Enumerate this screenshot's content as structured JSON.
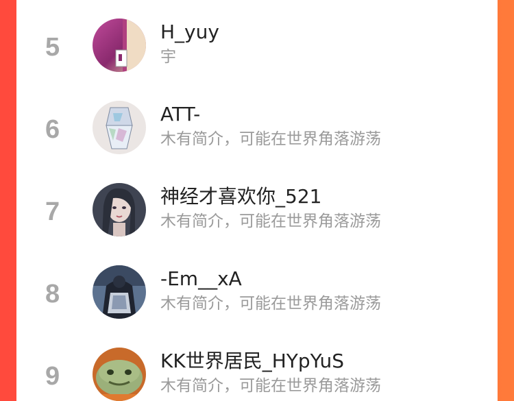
{
  "colors": {
    "background_left": "#ff4a3d",
    "background_right": "#ff7b3a",
    "panel": "#ffffff",
    "rank": "#a8a8a8",
    "name": "#222222",
    "bio": "#9a9a9a"
  },
  "ranking": {
    "items": [
      {
        "rank": "5",
        "name": "H_yuy",
        "bio": "宇",
        "avatar_icon": "photo-avatar-purple-room"
      },
      {
        "rank": "6",
        "name": "ATT-",
        "bio": "木有简介，可能在世界角落游荡",
        "avatar_icon": "illustrated-avatar-crystal"
      },
      {
        "rank": "7",
        "name": "神经才喜欢你_521",
        "bio": "木有简介，可能在世界角落游荡",
        "avatar_icon": "illustrated-avatar-girl"
      },
      {
        "rank": "8",
        "name": "-Em__xA",
        "bio": "木有简介，可能在世界角落游荡",
        "avatar_icon": "illustrated-avatar-dark-figure"
      },
      {
        "rank": "9",
        "name": "KK世界居民_HYpYuS",
        "bio": "木有简介，可能在世界角落游荡",
        "avatar_icon": "photo-avatar-green-frog"
      }
    ]
  }
}
